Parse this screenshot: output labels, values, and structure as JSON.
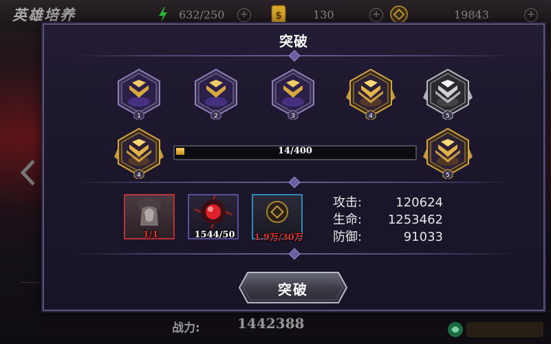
{
  "header": {
    "title": "英雄培养",
    "stamina": "632/250",
    "tickets": "130",
    "coins": "19843"
  },
  "footer": {
    "power_label": "战力:",
    "power_value": "1442388"
  },
  "modal": {
    "title": "突破",
    "ranks": [
      {
        "level": "1",
        "tier": "purple"
      },
      {
        "level": "2",
        "tier": "purple"
      },
      {
        "level": "3",
        "tier": "purple"
      },
      {
        "level": "4",
        "tier": "gold"
      },
      {
        "level": "5",
        "tier": "silver"
      }
    ],
    "current_rank": {
      "level": "4",
      "tier": "gold"
    },
    "next_rank": {
      "level": "5",
      "tier": "gold"
    },
    "progress": {
      "text": "14/400",
      "value": 14,
      "max": 400
    },
    "materials": [
      {
        "name": "hero-shard",
        "label": "1/1",
        "label_color": "#e03030",
        "frame_color": "#b8323a"
      },
      {
        "name": "red-crystal",
        "label": "1544/50",
        "label_color": "#ffffff",
        "frame_color": "#5a4f9a"
      },
      {
        "name": "coin",
        "label": "1.9万/30万",
        "label_color": "#e03030",
        "frame_color": "#2f8bb8"
      }
    ],
    "stats": [
      {
        "name": "攻击:",
        "value": "120624"
      },
      {
        "name": "生命:",
        "value": "1253462"
      },
      {
        "name": "防御:",
        "value": "91033"
      }
    ],
    "confirm_label": "突破"
  },
  "colors": {
    "accent_gold": "#e2b24a",
    "accent_purple": "#6c5fa0",
    "danger": "#e03030"
  }
}
